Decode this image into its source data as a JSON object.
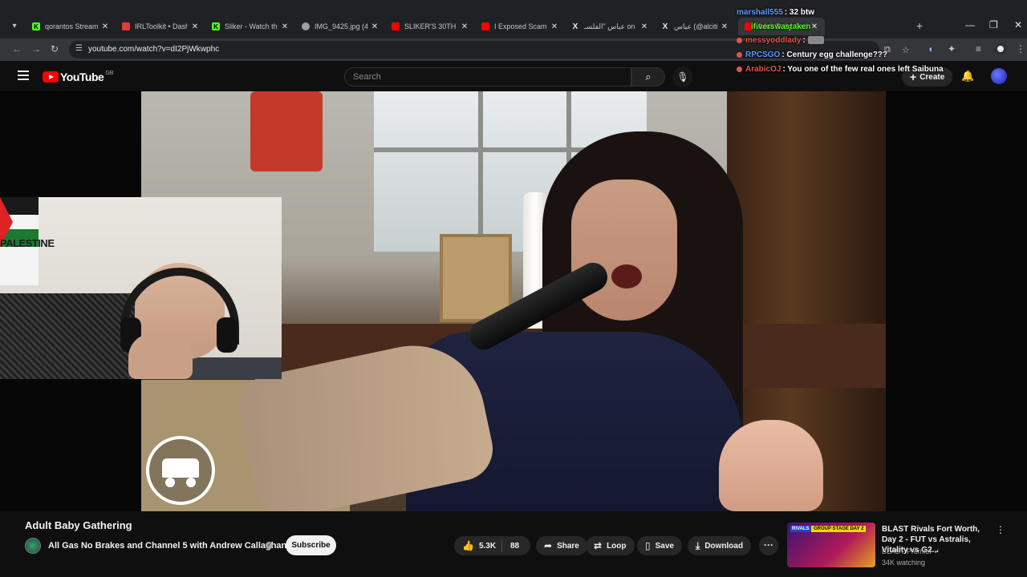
{
  "browser": {
    "tabs": [
      {
        "label": "qorantos Stream",
        "favicon": "kick-icon",
        "color": "#53fc18"
      },
      {
        "label": "IRLToolkit • Dashb",
        "favicon": "irltoolkit-icon",
        "color": "#e53935"
      },
      {
        "label": "Sliker - Watch the",
        "favicon": "kick-icon",
        "color": "#53fc18"
      },
      {
        "label": "IMG_9425.jpg (45",
        "favicon": "globe-icon",
        "color": "#9aa0a6"
      },
      {
        "label": "SLIKER'S 30TH BI",
        "favicon": "youtube-icon",
        "color": "#ff0000"
      },
      {
        "label": "I Exposed Scamm",
        "favicon": "youtube-icon",
        "color": "#ff0000"
      },
      {
        "label": "عباس \"الفلسـ on X",
        "favicon": "x-icon",
        "color": "#e8eaed"
      },
      {
        "label": "عباس (@alcitizen",
        "favicon": "x-icon",
        "color": "#e8eaed"
      },
      {
        "label": "Adult Baby Gathe",
        "favicon": "youtube-icon",
        "color": "#ff0000",
        "active": true
      }
    ],
    "url": "youtube.com/watch?v=dI2PjWkwphc"
  },
  "chat": [
    {
      "user": "marshall555",
      "color": "#5b9bff",
      "msg": ": 32 btw",
      "dot": false
    },
    {
      "user": "ifiverswastaken",
      "color": "#53fc18",
      "msg": "",
      "dot": false
    },
    {
      "user": "messyoddlady",
      "color": "#e0544d",
      "msg": ":",
      "dot": true
    },
    {
      "user": "RPCSGO",
      "color": "#5b9bff",
      "msg": ": Century egg challenge???",
      "dot": true
    },
    {
      "user": "ArabicOJ",
      "color": "#e0544d",
      "msg": ": You one of the few real ones left Saibuna",
      "dot": true
    }
  ],
  "youtube": {
    "search_placeholder": "Search",
    "create_label": "Create",
    "logo_text": "YouTube",
    "country_code": "GB"
  },
  "video": {
    "title": "Adult Baby Gathering",
    "channel": "All Gas No Brakes and Channel 5 with Andrew Callaghan",
    "subscribe_label": "Subscribe",
    "likes": "5.3K",
    "dislikes": "88",
    "actions": {
      "share": "Share",
      "loop": "Loop",
      "save": "Save",
      "download": "Download"
    },
    "webcam_flag_text": "PALESTINE"
  },
  "recommendation": {
    "title": "BLAST Rivals Fort Worth, Day 2 - FUT vs Astralis, Vitality vs G2...",
    "channel": "BLAST Premier",
    "views": "34K watching",
    "thumb_tag": "RIVALS",
    "thumb_tag2": "GROUP STAGE DAY 2"
  }
}
